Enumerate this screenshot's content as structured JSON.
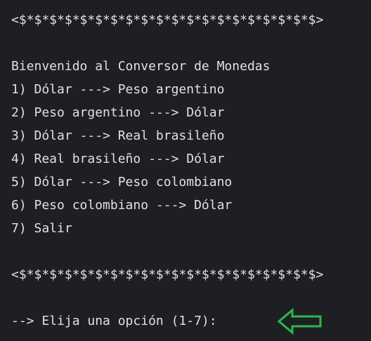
{
  "console": {
    "separator_top": "<$*$*$*$*$*$*$*$*$*$*$*$*$*$*$*$*$*$*$*$>",
    "title": "Bienvenido al Conversor de Monedas",
    "options": [
      "1) Dólar ---> Peso argentino",
      "2) Peso argentino ---> Dólar",
      "3) Dólar ---> Real brasileño",
      "4) Real brasileño ---> Dólar",
      "5) Dólar ---> Peso colombiano",
      "6) Peso colombiano ---> Dólar",
      "7) Salir"
    ],
    "separator_bottom": "<$*$*$*$*$*$*$*$*$*$*$*$*$*$*$*$*$*$*$*$>",
    "prompt": "--> Elija una opción (1-7):"
  },
  "colors": {
    "background": "#1e1f22",
    "text": "#dfe1e5",
    "arrow": "#2db84a"
  },
  "icons": {
    "pointer": "left-arrow-icon"
  }
}
